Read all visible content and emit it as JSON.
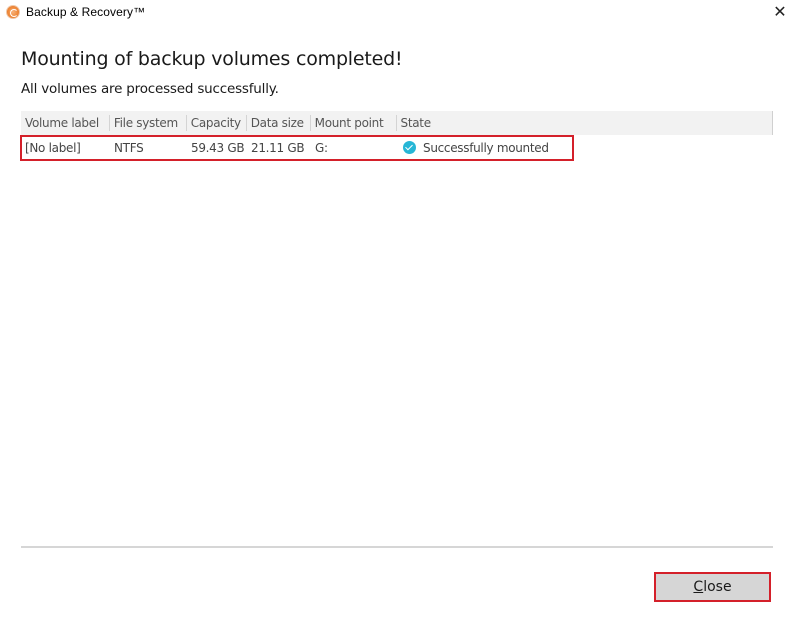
{
  "window": {
    "title": "Backup & Recovery™",
    "close_glyph": "✕"
  },
  "dialog": {
    "heading": "Mounting of backup volumes completed!",
    "subheading": "All volumes are processed successfully."
  },
  "table": {
    "columns": [
      "Volume label",
      "File system",
      "Capacity",
      "Data size",
      "Mount point",
      "State"
    ],
    "rows": [
      {
        "volume_label": "[No label]",
        "file_system": "NTFS",
        "capacity": "59.43 GB",
        "data_size": "21.11 GB",
        "mount_point": "G:",
        "state": "Successfully mounted",
        "state_icon": "check-circle-icon",
        "state_color": "#26b6d6"
      }
    ]
  },
  "footer": {
    "close_mnemonic": "C",
    "close_rest": "lose"
  },
  "colors": {
    "highlight": "#d4202a",
    "header_bg": "#f2f2f2",
    "button_bg": "#d6d6d6",
    "success": "#26b6d6"
  }
}
